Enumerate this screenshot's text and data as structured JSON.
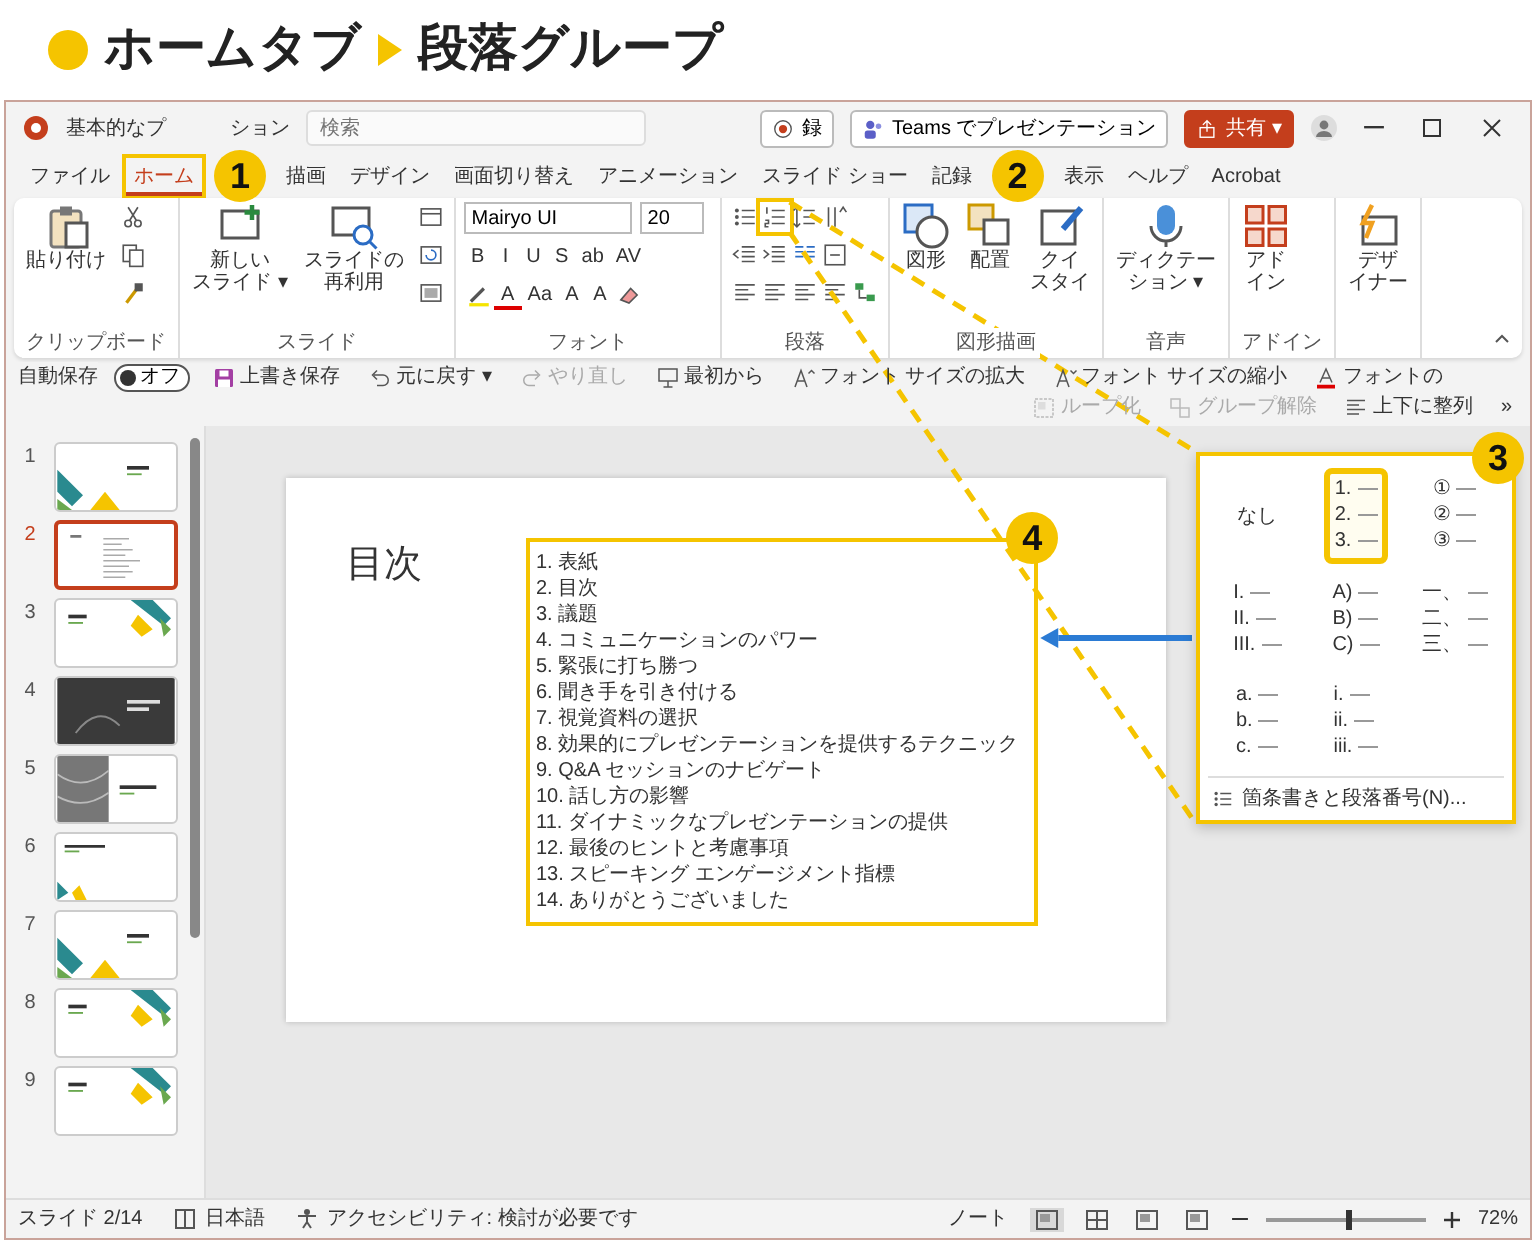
{
  "heading": {
    "title_1": "ホームタブ",
    "title_2": "段落グループ"
  },
  "window": {
    "title_parts": [
      "基本的なプ",
      "ション"
    ],
    "search": {
      "placeholder": "検索"
    },
    "buttons": [
      {
        "kind": "record",
        "label": "録"
      },
      {
        "kind": "teams",
        "label": "Teams でプレゼンテーション"
      },
      {
        "kind": "share",
        "label": "共有 ▾"
      }
    ]
  },
  "tab_row": [
    {
      "kind": "tab",
      "label": "ファイル",
      "selected": false,
      "highlighted": false
    },
    {
      "kind": "tab",
      "label": "ホーム",
      "selected": true,
      "highlighted": true
    },
    {
      "kind": "callout",
      "label": "1"
    },
    {
      "kind": "tab",
      "label": "描画",
      "selected": false,
      "highlighted": false
    },
    {
      "kind": "tab",
      "label": "デザイン",
      "selected": false,
      "highlighted": false
    },
    {
      "kind": "tab",
      "label": "画面切り替え",
      "selected": false,
      "highlighted": false
    },
    {
      "kind": "tab",
      "label": "アニメーション",
      "selected": false,
      "highlighted": false
    },
    {
      "kind": "tab",
      "label": "スライド ショー",
      "selected": false,
      "highlighted": false
    },
    {
      "kind": "tab",
      "label": "記録",
      "selected": false,
      "highlighted": false
    },
    {
      "kind": "callout",
      "label": "2"
    },
    {
      "kind": "tab",
      "label": "表示",
      "selected": false,
      "highlighted": false
    },
    {
      "kind": "tab",
      "label": "ヘルプ",
      "selected": false,
      "highlighted": false
    },
    {
      "kind": "tab",
      "label": "Acrobat",
      "selected": false,
      "highlighted": false
    }
  ],
  "ribbon": [
    {
      "label": "クリップボード",
      "columns": [
        {
          "rows": [
            [
              {
                "kind": "paste",
                "lines": [
                  "貼り付け"
                ]
              }
            ]
          ]
        },
        {
          "rows": [
            [
              {
                "kind": "scissors"
              }
            ],
            [
              {
                "kind": "copy"
              }
            ],
            [
              {
                "kind": "brush"
              }
            ]
          ]
        }
      ]
    },
    {
      "label": "スライド",
      "columns": [
        {
          "rows": [
            [
              {
                "kind": "newslide",
                "lines": [
                  "新しい",
                  "スライド ▾"
                ]
              }
            ]
          ]
        },
        {
          "rows": [
            [
              {
                "kind": "reuse",
                "lines": [
                  "スライドの",
                  "再利用"
                ]
              }
            ]
          ]
        },
        {
          "rows": [
            [
              {
                "kind": "layout"
              }
            ],
            [
              {
                "kind": "reset"
              }
            ],
            [
              {
                "kind": "section"
              }
            ]
          ]
        }
      ]
    },
    {
      "label": "フォント",
      "columns": [
        {
          "rows": [
            {
              "items": [
                {
                  "kind": "select",
                  "value": "Mairyo UI"
                },
                {
                  "kind": "select",
                  "value": "20"
                }
              ]
            },
            {
              "items": [
                {
                  "kind": "text",
                  "text": "B"
                },
                {
                  "kind": "text",
                  "text": "I"
                },
                {
                  "kind": "text",
                  "text": "U"
                },
                {
                  "kind": "text",
                  "text": "S"
                },
                {
                  "kind": "text",
                  "text": "ab"
                },
                {
                  "kind": "text",
                  "text": "AV"
                }
              ]
            },
            {
              "items": [
                {
                  "kind": "highlighter"
                },
                {
                  "kind": "fontcolor",
                  "text": "A"
                },
                {
                  "kind": "text",
                  "text": "Aa"
                },
                {
                  "kind": "text",
                  "text": "A"
                },
                {
                  "kind": "text",
                  "text": "A"
                },
                {
                  "kind": "clear"
                }
              ]
            }
          ]
        }
      ]
    },
    {
      "label": "段落",
      "columns": [
        {
          "rows": [
            {
              "items": [
                {
                  "kind": "bullets"
                },
                {
                  "kind": "numbering",
                  "highlighted": true
                },
                {
                  "kind": "linespacing"
                },
                {
                  "kind": "direction"
                }
              ]
            },
            {
              "items": [
                {
                  "kind": "outdent"
                },
                {
                  "kind": "indent"
                },
                {
                  "kind": "columns"
                },
                {
                  "kind": "textalign"
                }
              ]
            },
            {
              "items": [
                {
                  "kind": "align"
                },
                {
                  "kind": "align"
                },
                {
                  "kind": "align"
                },
                {
                  "kind": "align"
                },
                {
                  "kind": "smartart"
                }
              ]
            }
          ]
        }
      ]
    },
    {
      "label": "図形描画",
      "columns": [
        {
          "rows": [
            [
              {
                "kind": "shapes",
                "lines": [
                  "図形"
                ]
              }
            ]
          ]
        },
        {
          "rows": [
            [
              {
                "kind": "arrange",
                "lines": [
                  "配置"
                ]
              }
            ]
          ]
        },
        {
          "rows": [
            [
              {
                "kind": "quickstyle",
                "lines": [
                  "クイ",
                  "スタイ"
                ]
              }
            ]
          ]
        }
      ]
    },
    {
      "label": "音声",
      "columns": [
        {
          "rows": [
            [
              {
                "kind": "mic",
                "lines": [
                  "ディクテー",
                  "ション ▾"
                ]
              }
            ]
          ]
        }
      ]
    },
    {
      "label": "アドイン",
      "columns": [
        {
          "rows": [
            [
              {
                "kind": "addin",
                "lines": [
                  "アド",
                  "イン"
                ]
              }
            ]
          ]
        }
      ]
    },
    {
      "columns": [
        {
          "rows": [
            [
              {
                "kind": "designer",
                "lines": [
                  "デザ",
                  "イナー"
                ]
              }
            ]
          ]
        }
      ]
    }
  ],
  "quick_access": {
    "left": [
      {
        "kind": "toggle",
        "label": "自動保存",
        "value": "オフ",
        "on": false
      },
      {
        "kind": "save",
        "label": "上書き保存",
        "disabled": false
      },
      {
        "kind": "undo",
        "label": "元に戻す ▾",
        "disabled": false
      },
      {
        "kind": "redo",
        "label": "やり直し",
        "disabled": true
      },
      {
        "kind": "slideshow",
        "label": "最初から",
        "disabled": false
      },
      {
        "kind": "grow",
        "label": "フォント サイズの拡大",
        "disabled": false
      },
      {
        "kind": "shrink",
        "label": "フォント サイズの縮小",
        "disabled": false
      },
      {
        "kind": "fontcolor",
        "label": "フォントの",
        "disabled": false
      }
    ],
    "right": [
      {
        "kind": "group",
        "label": "ループ化",
        "disabled": true
      },
      {
        "kind": "ungroup",
        "label": "グループ解除",
        "disabled": true
      },
      {
        "kind": "align",
        "label": "上下に整列",
        "disabled": false
      },
      {
        "kind": "more",
        "label": "»",
        "disabled": false
      }
    ]
  },
  "slides": [
    {
      "number": "1",
      "kind": "title",
      "selected": false
    },
    {
      "number": "2",
      "kind": "list",
      "selected": true
    },
    {
      "number": "3",
      "kind": "corner",
      "selected": false
    },
    {
      "number": "4",
      "kind": "photo",
      "selected": false
    },
    {
      "number": "5",
      "kind": "split",
      "selected": false
    },
    {
      "number": "6",
      "kind": "bottomleft",
      "selected": false
    },
    {
      "number": "7",
      "kind": "title",
      "selected": false
    },
    {
      "number": "8",
      "kind": "corner",
      "selected": false
    },
    {
      "number": "9",
      "kind": "corner",
      "selected": false
    }
  ],
  "slide": {
    "title": "目次",
    "callout": "4",
    "items": [
      {
        "number": "1.",
        "text": "表紙"
      },
      {
        "number": "2.",
        "text": "目次"
      },
      {
        "number": "3.",
        "text": "議題"
      },
      {
        "number": "4.",
        "text": "コミュニケーションのパワー"
      },
      {
        "number": "5.",
        "text": "緊張に打ち勝つ"
      },
      {
        "number": "6.",
        "text": "聞き手を引き付ける"
      },
      {
        "number": "7.",
        "text": "視覚資料の選択"
      },
      {
        "number": "8.",
        "text": "効果的にプレゼンテーションを提供するテクニック"
      },
      {
        "number": "9.",
        "text": "Q&A セッションのナビゲート"
      },
      {
        "number": "10.",
        "text": "話し方の影響"
      },
      {
        "number": "11.",
        "text": "ダイナミックなプレゼンテーションの提供"
      },
      {
        "number": "12.",
        "text": "最後のヒントと考慮事項"
      },
      {
        "number": "13.",
        "text": "スピーキング エンゲージメント指標"
      },
      {
        "number": "14.",
        "text": "ありがとうございました"
      }
    ]
  },
  "numbering_gallery": {
    "callout": "3",
    "options": [
      {
        "kind": "none",
        "label": "なし",
        "selected": false
      },
      {
        "kind": "list",
        "lines": [
          "1.",
          "2.",
          "3."
        ],
        "selected": true
      },
      {
        "kind": "list",
        "lines": [
          "①",
          "②",
          "③"
        ],
        "selected": false
      },
      {
        "kind": "list",
        "lines": [
          "I.",
          "II.",
          "III."
        ],
        "selected": false
      },
      {
        "kind": "list",
        "lines": [
          "A)",
          "B)",
          "C)"
        ],
        "selected": false
      },
      {
        "kind": "list",
        "lines": [
          "一、",
          "二、",
          "三、"
        ],
        "selected": false
      },
      {
        "kind": "list",
        "lines": [
          "a.",
          "b.",
          "c."
        ],
        "selected": false
      },
      {
        "kind": "list",
        "lines": [
          "i.",
          "ii.",
          "iii."
        ],
        "selected": false
      }
    ],
    "footer": "箇条書きと段落番号(N)..."
  },
  "status_bar": {
    "slide": "スライド 2/14",
    "language": "日本語",
    "accessibility": "アクセシビリティ: 検討が必要です",
    "notes": "ノート",
    "views": [
      {
        "selected": true
      },
      {
        "selected": false
      },
      {
        "selected": false
      },
      {
        "selected": false
      }
    ],
    "zoom": {
      "level": 0.5,
      "reading": "72%"
    }
  }
}
